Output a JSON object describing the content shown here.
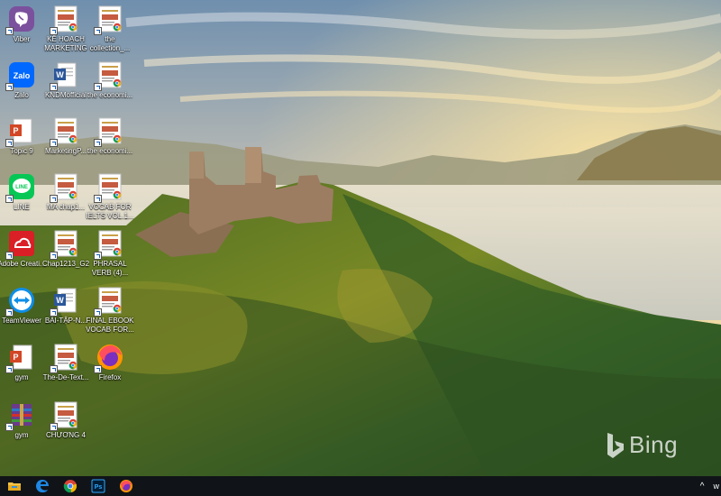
{
  "desktop": {
    "icons": [
      {
        "label": "Viber",
        "icon": "viber-icon",
        "color": "#7b519d"
      },
      {
        "label": "KẾ HOẠCH MARKETING",
        "icon": "pdf-document-icon"
      },
      {
        "label": "the collection_...",
        "icon": "pdf-document-icon"
      },
      {
        "label": "Zalo",
        "icon": "zalo-icon",
        "color": "#0068ff"
      },
      {
        "label": "KNDMofficial",
        "icon": "word-document-icon"
      },
      {
        "label": "the economi...",
        "icon": "pdf-document-icon"
      },
      {
        "label": "Topic 9",
        "icon": "powerpoint-document-icon"
      },
      {
        "label": "MarketingP...",
        "icon": "pdf-document-icon"
      },
      {
        "label": "the economi...",
        "icon": "pdf-document-icon"
      },
      {
        "label": "LINE",
        "icon": "line-icon",
        "color": "#06c755"
      },
      {
        "label": "MA chap1...",
        "icon": "pdf-document-icon"
      },
      {
        "label": "VOCAB FOR IELTS VOL.1...",
        "icon": "pdf-document-icon"
      },
      {
        "label": "Adobe Creati...",
        "icon": "adobe-creative-cloud-icon",
        "color": "#da1f26"
      },
      {
        "label": "Chap1213_G2",
        "icon": "pdf-document-icon"
      },
      {
        "label": "PHRASAL VERB (4)...",
        "icon": "pdf-document-icon"
      },
      {
        "label": "TeamViewer",
        "icon": "teamviewer-icon",
        "color": "#0e8ee9"
      },
      {
        "label": "BÀI-TẬP-N...",
        "icon": "word-document-icon"
      },
      {
        "label": "FINAL EBOOK VOCAB FOR...",
        "icon": "pdf-document-icon"
      },
      {
        "label": "gym",
        "icon": "powerpoint-document-icon"
      },
      {
        "label": "The-De-Text...",
        "icon": "pdf-document-icon"
      },
      {
        "label": "Firefox",
        "icon": "firefox-icon"
      },
      {
        "label": "gym",
        "icon": "winrar-archive-icon"
      },
      {
        "label": "CHƯƠNG 4",
        "icon": "pdf-document-icon"
      }
    ]
  },
  "wallpaper": {
    "watermark": "Bing"
  },
  "taskbar": {
    "buttons": [
      {
        "name": "file-explorer-icon"
      },
      {
        "name": "edge-icon"
      },
      {
        "name": "chrome-icon"
      },
      {
        "name": "photoshop-icon",
        "text": "Ps"
      },
      {
        "name": "firefox-icon"
      }
    ],
    "tray_chevron": "^",
    "tray_text": "w"
  }
}
